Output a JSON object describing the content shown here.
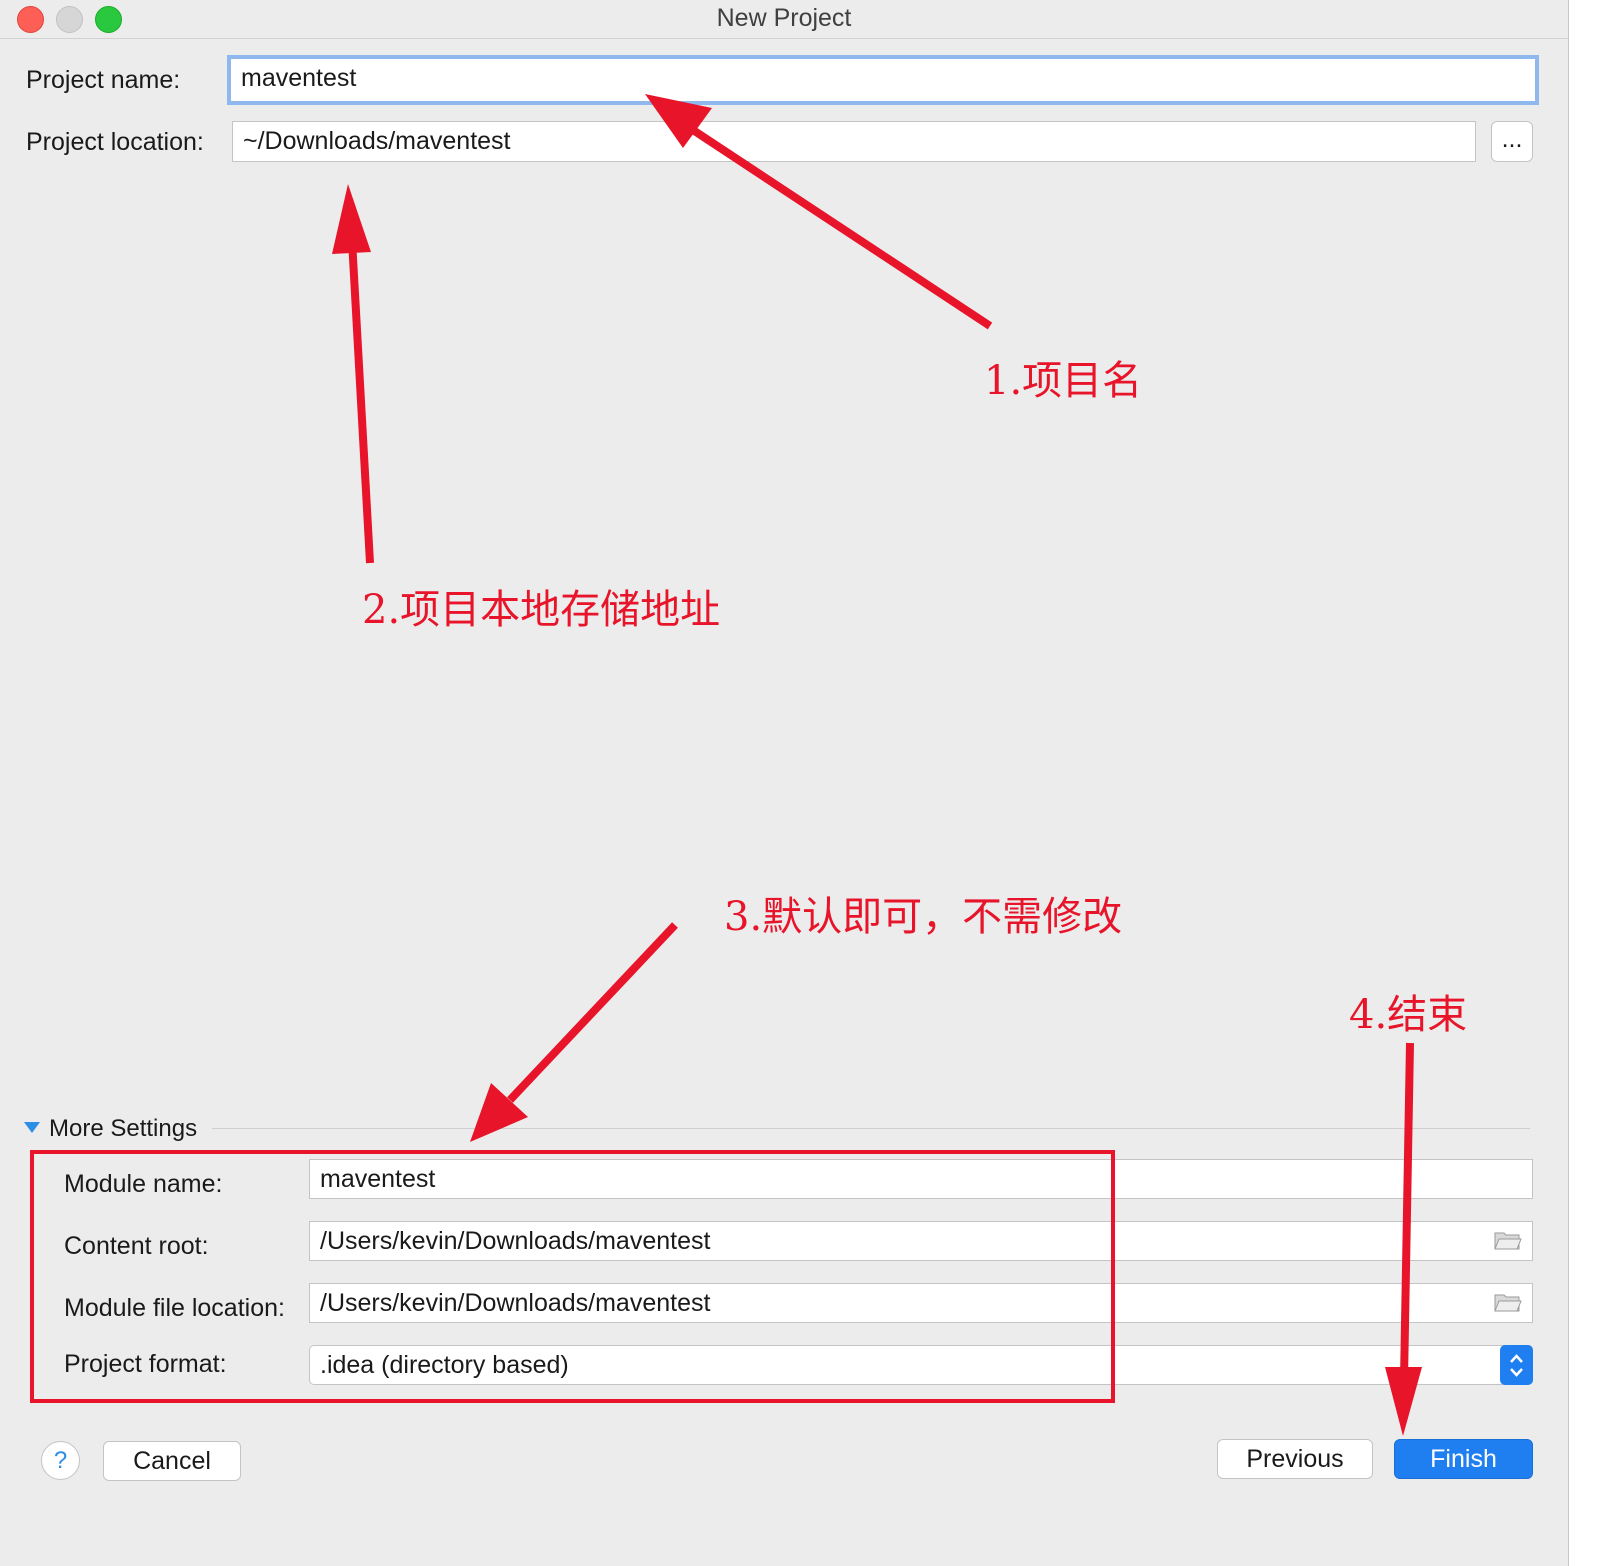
{
  "window": {
    "title": "New Project"
  },
  "form": {
    "project_name_label": "Project name:",
    "project_name_value": "maventest",
    "project_location_label": "Project location:",
    "project_location_value": "~/Downloads/maventest",
    "browse_button": "..."
  },
  "more_settings": {
    "label": "More Settings",
    "module_name_label": "Module name:",
    "module_name_value": "maventest",
    "content_root_label": "Content root:",
    "content_root_value": "/Users/kevin/Downloads/maventest",
    "module_file_location_label": "Module file location:",
    "module_file_location_value": "/Users/kevin/Downloads/maventest",
    "project_format_label": "Project format:",
    "project_format_value": ".idea (directory based)"
  },
  "footer": {
    "help_label": "?",
    "cancel_label": "Cancel",
    "previous_label": "Previous",
    "finish_label": "Finish"
  },
  "annotations": {
    "a1": "1.项目名",
    "a2": "2.项目本地存储地址",
    "a3": "3.默认即可，不需修改",
    "a4": "4.结束"
  },
  "colors": {
    "annotation_red": "#e8142a",
    "finish_blue": "#1f7ff0",
    "focus_ring": "#8fb9ee"
  }
}
